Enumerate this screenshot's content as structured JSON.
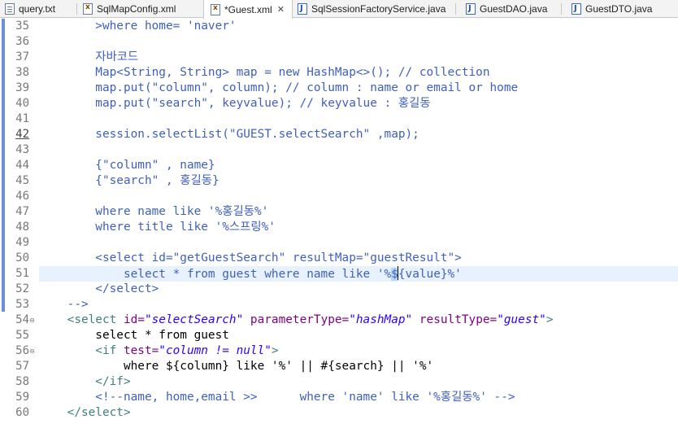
{
  "tabs": [
    {
      "label": "query.txt",
      "icon": "text-file-icon",
      "active": false
    },
    {
      "label": "SqlMapConfig.xml",
      "icon": "xml-file-icon",
      "active": false
    },
    {
      "label": "*Guest.xml",
      "icon": "xml-file-icon",
      "active": true,
      "close": "✕"
    },
    {
      "label": "SqlSessionFactoryService.java",
      "icon": "java-file-icon",
      "active": false
    },
    {
      "label": "GuestDAO.java",
      "icon": "java-file-icon",
      "active": false
    },
    {
      "label": "GuestDTO.java",
      "icon": "java-file-icon",
      "active": false
    }
  ],
  "editor": {
    "current_line": 51,
    "lines": [
      {
        "n": "35",
        "text": "        >where home= 'naver'"
      },
      {
        "n": "36",
        "text": ""
      },
      {
        "n": "37",
        "text": "        자바코드"
      },
      {
        "n": "38",
        "text": "        Map<String, String> map = new HashMap<>(); // collection"
      },
      {
        "n": "39",
        "text": "        map.put(\"column\", column); // column : name or email or home"
      },
      {
        "n": "40",
        "text": "        map.put(\"search\", keyvalue); // keyvalue : 홍길동"
      },
      {
        "n": "41",
        "text": ""
      },
      {
        "n": "42",
        "text": "        session.selectList(\"GUEST.selectSearch\" ,map);"
      },
      {
        "n": "43",
        "text": ""
      },
      {
        "n": "44",
        "text": "        {\"column\" , name}"
      },
      {
        "n": "45",
        "text": "        {\"search\" , 홍길동}"
      },
      {
        "n": "46",
        "text": ""
      },
      {
        "n": "47",
        "text": "        where name like '%홍길동%'"
      },
      {
        "n": "48",
        "text": "        where title like '%스프링%'"
      },
      {
        "n": "49",
        "text": ""
      },
      {
        "n": "50",
        "text": "        <select id=\"getGuestSearch\" resultMap=\"guestResult\">"
      },
      {
        "n": "51",
        "text_before": "            select * from guest where name like '%",
        "text_sel": "$",
        "text_after": "{value}%'"
      },
      {
        "n": "52",
        "text": "        </select>"
      },
      {
        "n": "53",
        "text": "    -->"
      },
      {
        "n": "54",
        "fold": "⊖",
        "p1": "    <select ",
        "a1": "id=",
        "v1": "\"selectSearch\"",
        "a2": " parameterType=",
        "v2": "\"hashMap\"",
        "a3": " resultType=",
        "v3": "\"guest\"",
        "p2": ">"
      },
      {
        "n": "55",
        "text": "        select * from guest"
      },
      {
        "n": "56",
        "fold": "⊖",
        "p1": "        <if ",
        "a1": "test=",
        "v1": "\"column != null\"",
        "p2": ">"
      },
      {
        "n": "57",
        "text": "            where ${column} like '%' || #{search} || '%'"
      },
      {
        "n": "58",
        "text": "        </if>"
      },
      {
        "n": "59",
        "text": "        <!--name, home,email >>      where 'name' like '%홍길동%' -->"
      },
      {
        "n": "60",
        "text": "    </select>"
      }
    ]
  }
}
